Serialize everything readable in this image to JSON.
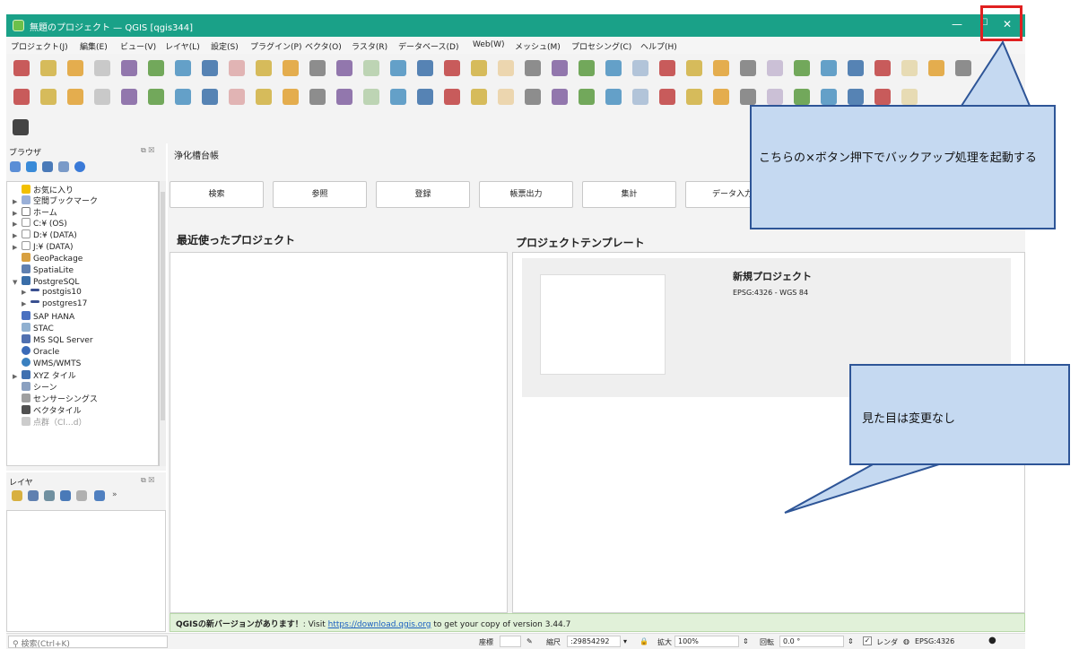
{
  "window": {
    "title": "無題のプロジェクト — QGIS [qgis344]",
    "minimize_glyph": "—",
    "maximize_glyph": "☐",
    "close_glyph": "✕"
  },
  "menu": [
    "プロジェクト(J)",
    "編集(E)",
    "ビュー(V)",
    "レイヤ(L)",
    "設定(S)",
    "プラグイン(P)",
    "ベクタ(O)",
    "ラスタ(R)",
    "データベース(D)",
    "Web(W)",
    "メッシュ(M)",
    "プロセシング(C)",
    "ヘルプ(H)"
  ],
  "browser_panel": {
    "title": "ブラウザ",
    "items": [
      "お気に入り",
      "空間ブックマーク",
      "ホーム",
      "C:¥ (OS)",
      "D:¥ (DATA)",
      "J:¥ (DATA)",
      "GeoPackage",
      "SpatiaLite",
      "PostgreSQL",
      "postgis10",
      "postgres17",
      "SAP HANA",
      "STAC",
      "MS SQL Server",
      "Oracle",
      "WMS/WMTS",
      "XYZ タイル",
      "シーン",
      "センサーシングス",
      "ベクタタイル"
    ],
    "last_partial": "点群（Cl…d）"
  },
  "layer_panel": {
    "title": "レイヤ"
  },
  "main": {
    "title": "浄化槽台帳",
    "nav_buttons": [
      "検索",
      "参照",
      "登録",
      "帳票出力",
      "集計",
      "データ入力"
    ],
    "recent_title": "最近使ったプロジェクト",
    "template_title": "プロジェクトテンプレート",
    "template_name": "新規プロジェクト",
    "template_crs": "EPSG:4326 - WGS 84"
  },
  "message": {
    "bold": "QGISの新バージョンがあります！",
    "pre": ": Visit ",
    "link": "https://download.qgis.org",
    "post": " to get your copy of version 3.44.7"
  },
  "statusbar": {
    "search_placeholder": "検索(Ctrl+K)",
    "coord_label": "座標",
    "scale_label": "縮尺",
    "scale_value": ":29854292",
    "magnifier_label": "拡大",
    "magnifier_value": "100%",
    "rotation_label": "回転",
    "rotation_value": "0.0 °",
    "render_label": "レンダ",
    "crs": "EPSG:4326"
  },
  "annotations": {
    "close_note": "こちらの×ボタン押下でバックアップ処理を起動する",
    "visual_note": "見た目は変更なし"
  },
  "colors": {
    "titlebar": "#1aa188",
    "highlight": "#e02020",
    "callout_fill": "#c5d9f1",
    "callout_border": "#2e5597"
  }
}
